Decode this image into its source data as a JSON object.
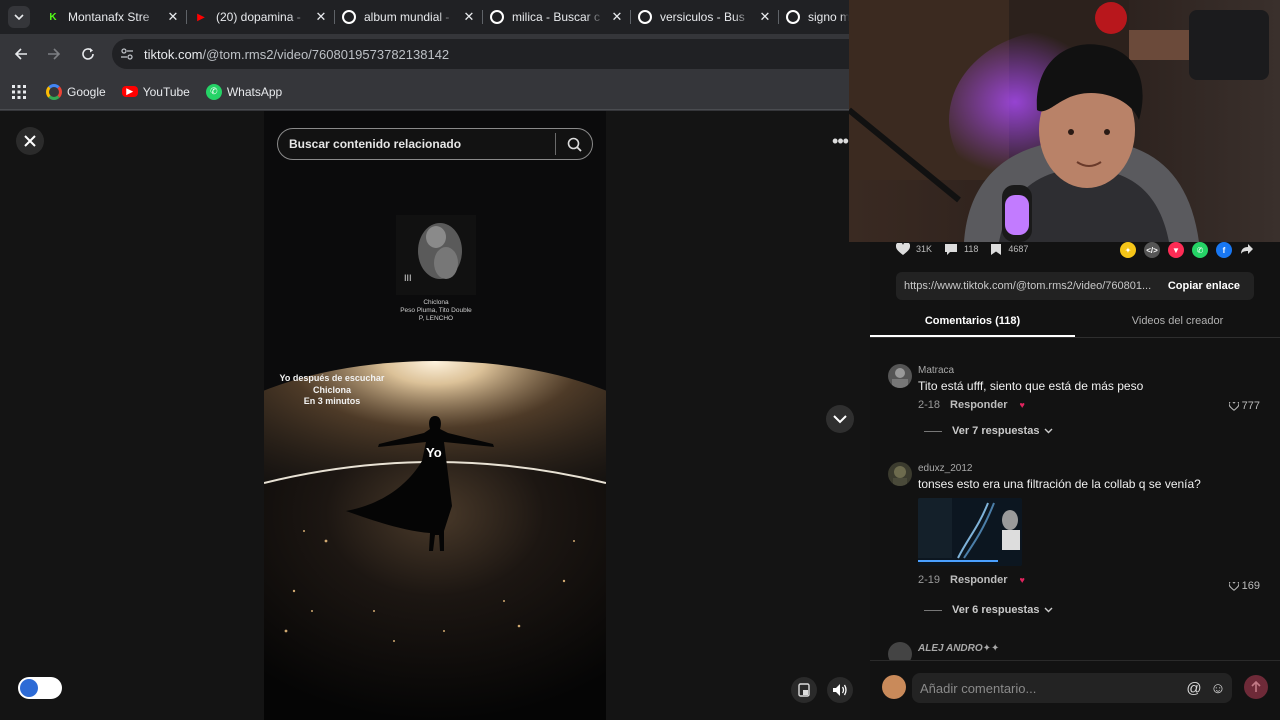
{
  "browser": {
    "tabs": [
      {
        "title": "Montanafx Stre",
        "icon": "kick-icon",
        "color": "#53fc18",
        "glyph": "K"
      },
      {
        "title": "(20) dopamina -",
        "icon": "youtube-icon",
        "color": "#ff0000",
        "glyph": "▶"
      },
      {
        "title": "album mundial -",
        "icon": "google-icon",
        "color": "#ffffff",
        "glyph": "G"
      },
      {
        "title": "milica - Buscar c",
        "icon": "google-icon",
        "color": "#ffffff",
        "glyph": "G"
      },
      {
        "title": "versiculos - Bus",
        "icon": "google-icon",
        "color": "#ffffff",
        "glyph": "G"
      },
      {
        "title": "signo m",
        "icon": "google-icon",
        "color": "#ffffff",
        "glyph": "G"
      }
    ],
    "close_glyph": "✕",
    "url_host": "tiktok.com",
    "url_path": "/@tom.rms2/video/7608019573782138142",
    "bookmarks": [
      {
        "label": "Google",
        "icon": "google-icon",
        "color": "#ffffff",
        "glyph": "G"
      },
      {
        "label": "YouTube",
        "icon": "youtube-icon",
        "color": "#ff0000",
        "glyph": "▶"
      },
      {
        "label": "WhatsApp",
        "icon": "whatsapp-icon",
        "color": "#25d366",
        "glyph": "✆"
      }
    ]
  },
  "video": {
    "search_placeholder": "Buscar contenido relacionado",
    "song_title": "Chiclona",
    "song_artists": "Peso Pluma, Tito Double",
    "song_feat": "P, LENCHO",
    "pause_glyph": "III",
    "caption_line1": "Yo después de escuchar",
    "caption_line2": "Chiclona",
    "caption_line3": "En 3 minutos",
    "figure_label": "Yo",
    "more_glyph": "•••"
  },
  "panel": {
    "likes": "31K",
    "comments_count": "118",
    "saves": "4687",
    "share_colors": [
      "#f5c518",
      "#555555",
      "#fe2c55",
      "#25d366",
      "#1877f2"
    ],
    "share_glyphs": [
      "✦",
      "</>",
      "▼",
      "✆",
      "f"
    ],
    "link": "https://www.tiktok.com/@tom.rms2/video/760801...",
    "copy_label": "Copiar enlace",
    "tab_comments": "Comentarios (118)",
    "tab_creator": "Videos del creador",
    "comments": [
      {
        "user": "Matraca",
        "text": "Tito está ufff, siento que está de más peso",
        "date": "2-18",
        "reply": "Responder",
        "likes": "777",
        "more": "Ver 7 respuestas"
      },
      {
        "user": "eduxz_2012",
        "text": "tonses esto era una filtración de la collab q se venía?",
        "date": "2-19",
        "reply": "Responder",
        "likes": "169",
        "more": "Ver 6 respuestas"
      },
      {
        "user": "ALEJ ANDRO✦✦",
        "text": "",
        "date": "",
        "reply": "",
        "likes": "",
        "more": ""
      }
    ],
    "composer_placeholder": "Añadir comentario...",
    "mention_glyph": "@",
    "emoji_glyph": "☺"
  }
}
